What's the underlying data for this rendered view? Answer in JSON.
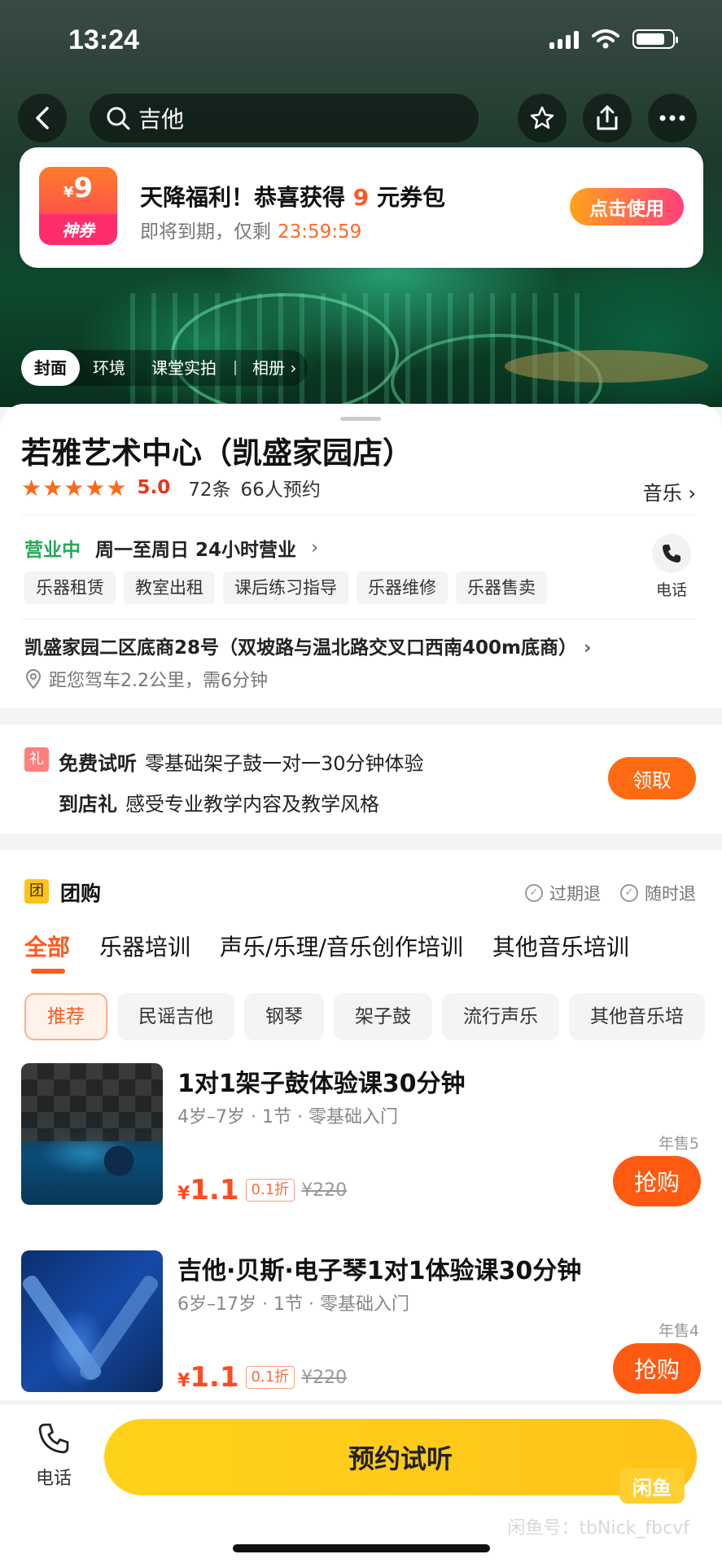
{
  "status_bar": {
    "time": "13:24"
  },
  "search": {
    "query": "吉他"
  },
  "coupon": {
    "amount": "9",
    "currency": "¥",
    "badge_label": "神券",
    "title_prefix": "天降福利！恭喜获得",
    "title_amount": "9",
    "title_suffix": "元券包",
    "expiry_text": "即将到期，仅剩",
    "countdown": "23:59:59",
    "use_button": "点击使用"
  },
  "album_tabs": {
    "items": [
      "封面",
      "环境",
      "课堂实拍"
    ],
    "album_label": "相册"
  },
  "shop": {
    "name": "若雅艺术中心（凯盛家园店）",
    "stars": "★★★★★",
    "score": "5.0",
    "reviews": "72条",
    "bookings": "66人预约",
    "category": "音乐",
    "open_status": "营业中",
    "hours": "周一至周日 24小时营业",
    "phone_label": "电话",
    "service_tags": [
      "乐器租赁",
      "教室出租",
      "课后练习指导",
      "乐器维修",
      "乐器售卖"
    ],
    "address": "凯盛家园二区底商28号（双坡路与温北路交叉口西南400m底商）",
    "distance": "距您驾车2.2公里，需6分钟"
  },
  "gift": {
    "badge": "礼",
    "line1_label": "免费试听",
    "line1_text": "零基础架子鼓一对一30分钟体验",
    "line2_label": "到店礼",
    "line2_text": "感受专业教学内容及教学风格",
    "claim_button": "领取"
  },
  "group_buy": {
    "badge": "团",
    "title": "团购",
    "guarantees": [
      "过期退",
      "随时退"
    ],
    "category_tabs": [
      "全部",
      "乐器培训",
      "声乐/乐理/音乐创作培训",
      "其他音乐培训"
    ],
    "sub_tabs": [
      "推荐",
      "民谣吉他",
      "钢琴",
      "架子鼓",
      "流行声乐",
      "其他音乐培"
    ],
    "deals": [
      {
        "title": "1对1架子鼓体验课30分钟",
        "meta": "4岁–7岁 · 1节 · 零基础入门",
        "sold": "年售5",
        "price_symbol": "¥",
        "price": "1.1",
        "discount": "0.1折",
        "original": "¥220",
        "buy_button": "抢购"
      },
      {
        "title": "吉他·贝斯·电子琴1对1体验课30分钟",
        "meta": "6岁–17岁 · 1节 · 零基础入门",
        "sold": "年售4",
        "price_symbol": "¥",
        "price": "1.1",
        "discount": "0.1折",
        "original": "¥220",
        "buy_button": "抢购"
      }
    ]
  },
  "bottom_bar": {
    "phone_label": "电话",
    "reserve_button": "预约试听",
    "logo_text": "闲鱼",
    "watermark": "闲鱼号：tbNick_fbcvf"
  }
}
